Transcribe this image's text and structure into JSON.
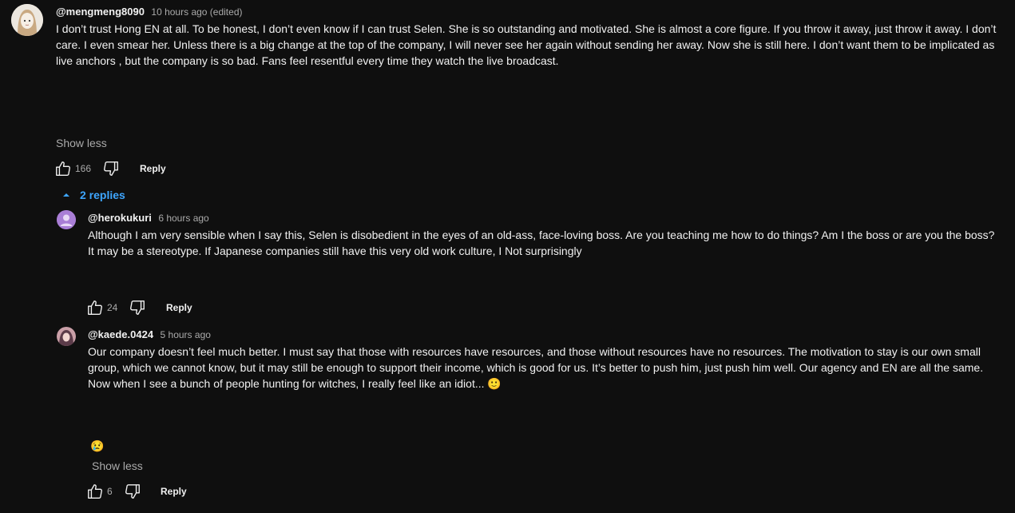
{
  "comment": {
    "handle": "@mengmeng8090",
    "time": "10 hours ago (edited)",
    "text": "I don’t trust Hong EN at all. To be honest, I don’t even know if I can trust Selen. She is so outstanding and motivated. She is almost a core figure. If you throw it away, just throw it away. I don’t care. I even smear her. Unless there is a big change at the top of the company, I will never see her again without sending her away. Now she is still here. I don’t want them to be implicated as live anchors , but the company is so bad. Fans feel resentful every time they watch the live broadcast.",
    "show_less": "Show less",
    "likes": "166",
    "reply_label": "Reply",
    "replies_toggle": "2 replies"
  },
  "replies": [
    {
      "handle": "@herokukuri",
      "time": "6 hours ago",
      "text": "Although I am very sensible when I say this, Selen is disobedient in the eyes of an old-ass, face-loving boss. Are you teaching me how to do things? Am I the boss or are you the boss? It may be a stereotype. If Japanese companies still have this very old work culture, I Not surprisingly",
      "likes": "24",
      "reply_label": "Reply"
    },
    {
      "handle": "@kaede.0424",
      "time": "5 hours ago",
      "text": "Our company doesn’t feel much better. I must say that those with resources have resources, and those without resources have no resources. The motivation to stay is our own small group, which we cannot know, but it may still be enough to support their income, which is good for us. It’s better to push him, just push him well. Our agency and EN are all the same. Now when I see a bunch of people hunting for witches, I really feel like an idiot...",
      "emoji_inline": "🙂",
      "emoji_line": "😢",
      "show_less": "Show less",
      "likes": "6",
      "reply_label": "Reply"
    }
  ],
  "colors": {
    "background": "#0f0f0f",
    "text": "#f1f1f1",
    "muted": "#aaaaaa",
    "link": "#3ea6ff"
  }
}
